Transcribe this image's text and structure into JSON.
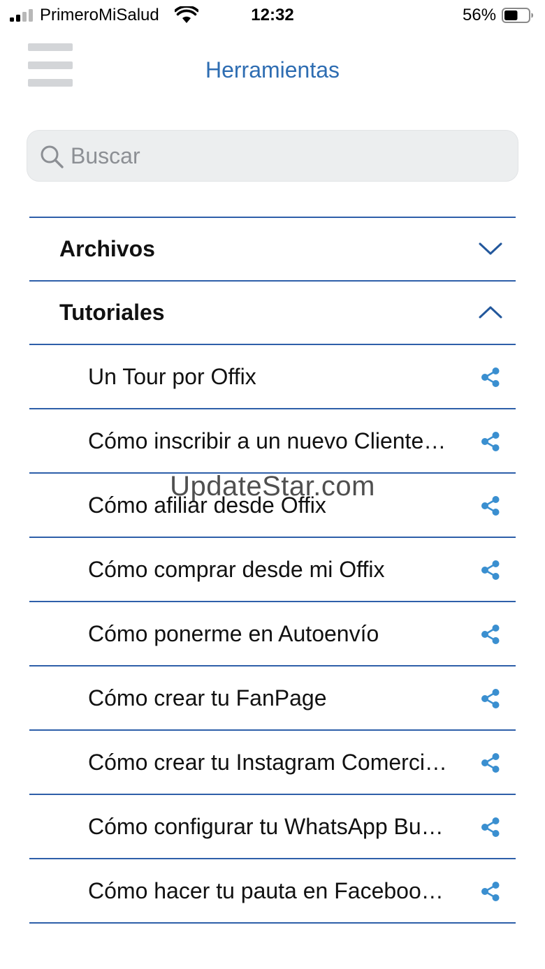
{
  "status_bar": {
    "carrier": "PrimeroMiSalud",
    "time": "12:32",
    "battery_percent": "56%",
    "battery_level": 0.56,
    "signal_bars_active": 2,
    "signal_bars_total": 4
  },
  "header": {
    "title": "Herramientas",
    "menu_icon": "hamburger-menu-icon"
  },
  "search": {
    "placeholder": "Buscar",
    "value": "",
    "icon": "search-icon"
  },
  "sections": [
    {
      "label": "Archivos",
      "expanded": false,
      "icon": "chevron-down-icon"
    },
    {
      "label": "Tutoriales",
      "expanded": true,
      "icon": "chevron-up-icon",
      "items": [
        {
          "label": "Un Tour por Offix",
          "icon": "share-icon"
        },
        {
          "label": "Cómo inscribir a un nuevo Cliente…",
          "icon": "share-icon"
        },
        {
          "label": "Cómo afiliar desde Offix",
          "icon": "share-icon"
        },
        {
          "label": "Cómo comprar desde mi Offix",
          "icon": "share-icon"
        },
        {
          "label": "Cómo ponerme en Autoenvío",
          "icon": "share-icon"
        },
        {
          "label": "Cómo crear tu FanPage",
          "icon": "share-icon"
        },
        {
          "label": "Cómo crear tu Instagram Comerci…",
          "icon": "share-icon"
        },
        {
          "label": "Cómo configurar tu WhatsApp Bu…",
          "icon": "share-icon"
        },
        {
          "label": "Cómo hacer tu pauta en Faceboo…",
          "icon": "share-icon"
        }
      ]
    }
  ],
  "watermark": "UpdateStar.com",
  "colors": {
    "accent": "#2e6db2",
    "divider": "#2e5fa9",
    "share_icon": "#3a8fd0",
    "chevron": "#23589c",
    "search_bg": "#eceeef"
  }
}
